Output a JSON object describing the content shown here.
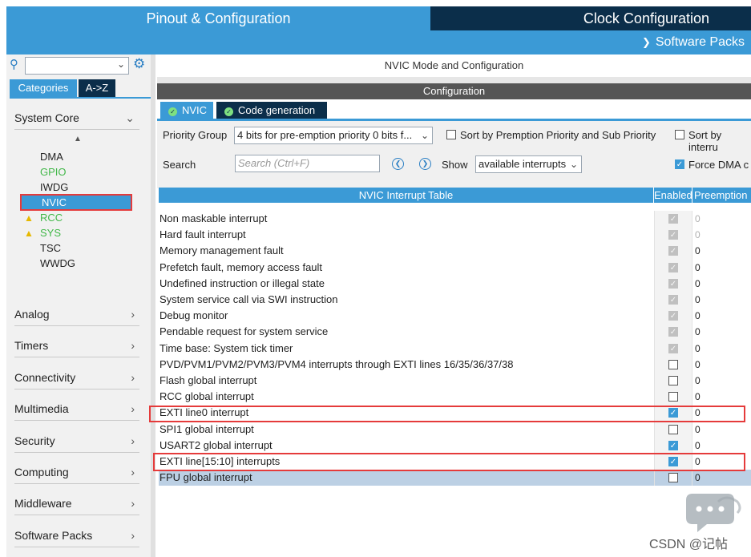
{
  "header": {
    "pinout_tab": "Pinout & Configuration",
    "clock_tab": "Clock Configuration",
    "software_packs": "Software Packs"
  },
  "sidebar": {
    "tab_categories": "Categories",
    "tab_atoz": "A->Z",
    "system_core": "System Core",
    "system_items": [
      "DMA",
      "GPIO",
      "IWDG",
      "NVIC",
      "RCC",
      "SYS",
      "TSC",
      "WWDG"
    ],
    "sections": [
      "Analog",
      "Timers",
      "Connectivity",
      "Multimedia",
      "Security",
      "Computing",
      "Middleware",
      "Software Packs"
    ]
  },
  "main": {
    "mode_title": "NVIC Mode and Configuration",
    "configuration": "Configuration",
    "tab_nvic": "NVIC",
    "tab_code": "Code generation",
    "priority_group_label": "Priority Group",
    "priority_group_value": "4 bits for pre-emption priority 0 bits f...",
    "sort_premption": "Sort by Premption Priority and Sub Priority",
    "sort_by_interrupts": "Sort by interru",
    "search_label": "Search",
    "search_placeholder": "Search (Ctrl+F)",
    "show_label": "Show",
    "show_value": "available interrupts",
    "force_dma": "Force DMA c"
  },
  "table": {
    "header_name": "NVIC Interrupt Table",
    "header_enabled": "Enabled",
    "header_preemption": "Preemption",
    "rows": [
      {
        "name": "Non maskable interrupt",
        "preempt": "0"
      },
      {
        "name": "Hard fault interrupt",
        "preempt": "0"
      },
      {
        "name": "Memory management fault",
        "preempt": "0"
      },
      {
        "name": "Prefetch fault, memory access fault",
        "preempt": "0"
      },
      {
        "name": "Undefined instruction or illegal state",
        "preempt": "0"
      },
      {
        "name": "System service call via SWI instruction",
        "preempt": "0"
      },
      {
        "name": "Debug monitor",
        "preempt": "0"
      },
      {
        "name": "Pendable request for system service",
        "preempt": "0"
      },
      {
        "name": "Time base: System tick timer",
        "preempt": "0"
      },
      {
        "name": "PVD/PVM1/PVM2/PVM3/PVM4 interrupts through EXTI lines 16/35/36/37/38",
        "preempt": "0"
      },
      {
        "name": "Flash global interrupt",
        "preempt": "0"
      },
      {
        "name": "RCC global interrupt",
        "preempt": "0"
      },
      {
        "name": "EXTI line0 interrupt",
        "preempt": "0"
      },
      {
        "name": "SPI1 global interrupt",
        "preempt": "0"
      },
      {
        "name": "USART2 global interrupt",
        "preempt": "0"
      },
      {
        "name": "EXTI line[15:10] interrupts",
        "preempt": "0"
      },
      {
        "name": "FPU global interrupt",
        "preempt": "0"
      }
    ]
  },
  "watermark": "CSDN @记帖",
  "colors": {
    "accent": "#3b9ad6",
    "dark": "#0b2e4a",
    "highlight": "#e53b3b"
  }
}
